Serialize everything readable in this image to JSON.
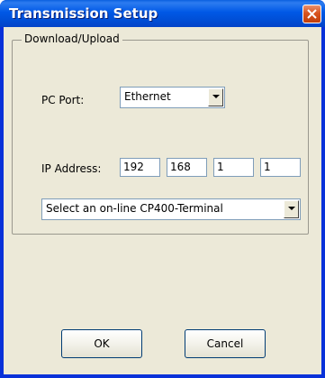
{
  "window": {
    "title": "Transmission Setup"
  },
  "group": {
    "label": "Download/Upload"
  },
  "pc_port": {
    "label": "PC Port:",
    "selected": "Ethernet"
  },
  "ip_address": {
    "label": "IP Address:",
    "octets": [
      "192",
      "168",
      "1",
      "1"
    ]
  },
  "terminal_select": {
    "selected": "Select an on-line CP400-Terminal"
  },
  "buttons": {
    "ok": "OK",
    "cancel": "Cancel"
  },
  "colors": {
    "titlebar": "#0058e6",
    "dialog_bg": "#ece9d8",
    "close_button": "#d9541e"
  }
}
